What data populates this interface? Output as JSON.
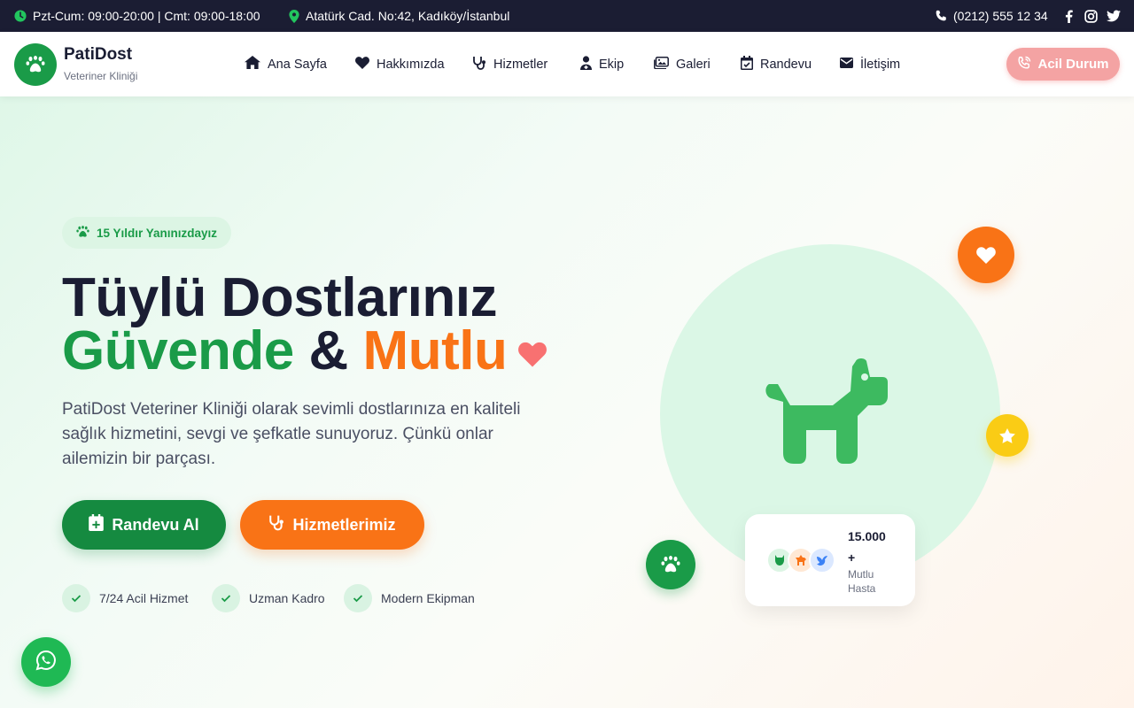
{
  "topbar": {
    "hours": "Pzt-Cum: 09:00-20:00 | Cmt: 09:00-18:00",
    "address": "Atatürk Cad. No:42, Kadıköy/İstanbul",
    "phone": "(0212) 555 12 34",
    "social": [
      "facebook-icon",
      "instagram-icon",
      "twitter-icon"
    ]
  },
  "header": {
    "brand": "PatiDost",
    "brand_sub": "Veteriner Kliniği",
    "nav": [
      {
        "label": "Ana Sayfa",
        "icon": "home-icon"
      },
      {
        "label": "Hakkımızda",
        "icon": "heart-icon"
      },
      {
        "label": "Hizmetler",
        "icon": "stethoscope-icon"
      },
      {
        "label": "Ekip",
        "icon": "doctor-icon"
      },
      {
        "label": "Galeri",
        "icon": "images-icon"
      },
      {
        "label": "Randevu",
        "icon": "calendar-icon"
      },
      {
        "label": "İletişim",
        "icon": "envelope-icon"
      }
    ],
    "emergency": "Acil Durum"
  },
  "hero": {
    "badge": "15 Yıldır Yanınızdayız",
    "title_line1": "Tüylü Dostlarınız",
    "title_green": "Güvende",
    "title_amp": "&",
    "title_orange": "Mutlu",
    "description": "PatiDost Veteriner Kliniği olarak sevimli dostlarınıza en kaliteli sağlık hizmetini, sevgi ve şefkatle sunuyoruz. Çünkü onlar ailemizin bir parçası.",
    "btn_primary": "Randevu Al",
    "btn_secondary": "Hizmetlerimiz",
    "features": [
      "7/24 Acil Hizmet",
      "Uzman Kadro",
      "Modern Ekipman"
    ]
  },
  "stats": {
    "count": "15.000",
    "plus": "+",
    "label": "Mutlu Hasta"
  },
  "colors": {
    "green": "#1a9b48",
    "orange": "#f97316",
    "dark": "#1b1d33",
    "yellow": "#facc15",
    "emergency": "#f4a3a3"
  }
}
